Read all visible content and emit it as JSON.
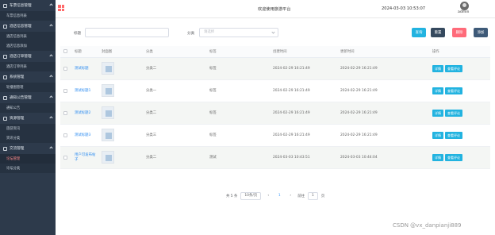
{
  "sidebar": {
    "groups": [
      {
        "label": "车票信息管理",
        "subs": [
          "车票信息列表"
        ]
      },
      {
        "label": "酒店信息管理",
        "subs": [
          "酒店信息列表",
          "酒店信息添加"
        ]
      },
      {
        "label": "酒店订单管理",
        "subs": [
          "酒店订单列表"
        ]
      },
      {
        "label": "系统管理",
        "subs": [
          "轮播图管理"
        ]
      },
      {
        "label": "通知公告管理",
        "subs": [
          "通知公告"
        ]
      },
      {
        "label": "资源管理",
        "subs": [
          "旅游资讯",
          "资讯分类"
        ]
      },
      {
        "label": "交流管理",
        "subs": [
          "论坛管理",
          "论坛分类"
        ]
      }
    ],
    "active_sub": "论坛管理"
  },
  "topbar": {
    "welcome": "欢迎使用旅游平台",
    "clock": "2024-03-03 10:53:07",
    "user": "admin"
  },
  "search": {
    "title_label": "标题",
    "title_value": "",
    "category_label": "分类",
    "category_placeholder": "请选择"
  },
  "buttons": {
    "query": "查询",
    "reset": "重置",
    "delete": "删除",
    "add": "添加"
  },
  "colors": {
    "query": "#22b3e0",
    "reset": "#35495e",
    "delete": "#ff6b7a",
    "add": "#3e5a78"
  },
  "table": {
    "headers": [
      "标题",
      "封面图",
      "分类",
      "标签",
      "创建时间",
      "更新时间",
      "操作"
    ],
    "rows": [
      {
        "title": "测试标题",
        "category": "分类二",
        "tag": "标签",
        "created": "2024-02-29 16:21:49",
        "updated": "2024-02-29 16:21:49"
      },
      {
        "title": "测试标题1",
        "category": "分类一",
        "tag": "标签",
        "created": "2024-02-29 16:21:49",
        "updated": "2024-02-29 16:21:49"
      },
      {
        "title": "测试标题2",
        "category": "分类二",
        "tag": "标签",
        "created": "2024-02-29 16:21:49",
        "updated": "2024-02-29 16:21:49"
      },
      {
        "title": "测试标题3",
        "category": "分类三",
        "tag": "标签",
        "created": "2024-02-29 16:21:49",
        "updated": "2024-02-29 16:21:49"
      },
      {
        "title": "用户可发布帖子",
        "category": "分类二",
        "tag": "测试",
        "created": "2024-03-03 10:43:51",
        "updated": "2024-03-03 10:44:04"
      }
    ],
    "op_detail": "详情",
    "op_comment": "查看评论"
  },
  "pager": {
    "total": "共 5 条",
    "page_size": "10条/页",
    "current": "1",
    "goto_label": "前往",
    "goto_value": "1",
    "page_suffix": "页"
  },
  "watermark": "CSDN @vx_danpianji889"
}
